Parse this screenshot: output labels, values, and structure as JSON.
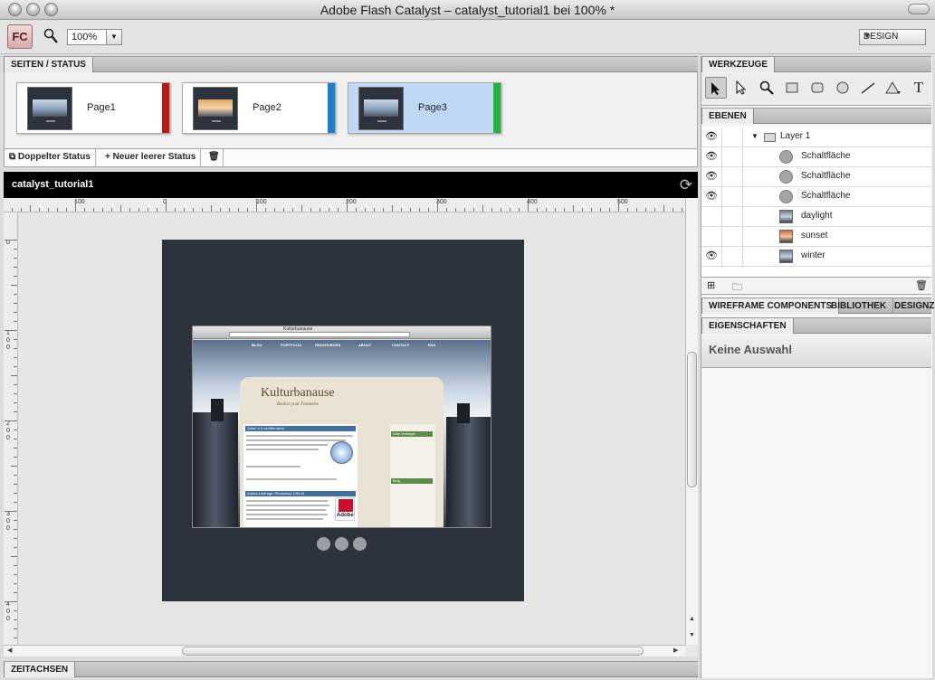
{
  "window": {
    "title": "Adobe Flash Catalyst – catalyst_tutorial1 bei 100% *"
  },
  "toolbar": {
    "logo": "FC",
    "zoom": "100%",
    "workspace": "DESIGN"
  },
  "pages_panel": {
    "tab": "SEITEN / STATUS",
    "pages": [
      {
        "label": "Page1",
        "color": "#c0170f"
      },
      {
        "label": "Page2",
        "color": "#1a7fd0"
      },
      {
        "label": "Page3",
        "color": "#1fb53a"
      }
    ],
    "actions": {
      "duplicate": "Doppelter Status",
      "new": "Neuer leerer Status"
    }
  },
  "document": {
    "name": "catalyst_tutorial1",
    "ruler_h": [
      "100",
      "0",
      "100",
      "200",
      "300",
      "400",
      "500"
    ],
    "ruler_v": [
      "0",
      "100",
      "200",
      "300",
      "400"
    ]
  },
  "site": {
    "browser_title": "Kulturbanause",
    "nav": [
      "BLOG",
      "PORTFOLIO",
      "RESSOURCEN",
      "ABOUT",
      "CONTACT",
      "RSS"
    ],
    "logo": "Kulturbanause",
    "slogan": "Realise your Fantasies",
    "post1": "Safari 4.0 veröffentlicht",
    "post2": "Adobe-Umfrage: Photoshop CS5 KI",
    "sidebar1": "Vote Verfolger",
    "sidebar2": "Blog",
    "adobe": "Adobe"
  },
  "tools_panel": {
    "tab": "WERKZEUGE"
  },
  "layers_panel": {
    "tab": "EBENEN",
    "rows": [
      {
        "name": "Layer 1",
        "visible": true,
        "type": "folder"
      },
      {
        "name": "Schaltfläche",
        "visible": true,
        "type": "button"
      },
      {
        "name": "Schaltfläche",
        "visible": true,
        "type": "button"
      },
      {
        "name": "Schaltfläche",
        "visible": true,
        "type": "button"
      },
      {
        "name": "daylight",
        "visible": false,
        "type": "image"
      },
      {
        "name": "sunset",
        "visible": false,
        "type": "image"
      },
      {
        "name": "winter",
        "visible": true,
        "type": "image"
      }
    ]
  },
  "library_tabs": [
    "WIREFRAME COMPONENTS",
    "BIBLIOTHEK",
    "DESIGNZ"
  ],
  "properties": {
    "tab": "EIGENSCHAFTEN",
    "empty": "Keine Auswahl"
  },
  "timeline": {
    "tab": "ZEITACHSEN"
  }
}
